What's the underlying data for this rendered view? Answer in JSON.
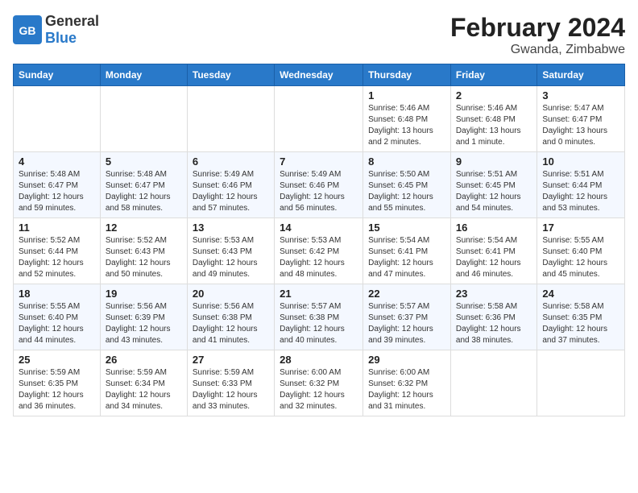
{
  "header": {
    "logo_general": "General",
    "logo_blue": "Blue",
    "month_year": "February 2024",
    "location": "Gwanda, Zimbabwe"
  },
  "days_of_week": [
    "Sunday",
    "Monday",
    "Tuesday",
    "Wednesday",
    "Thursday",
    "Friday",
    "Saturday"
  ],
  "weeks": [
    [
      {
        "day": "",
        "detail": ""
      },
      {
        "day": "",
        "detail": ""
      },
      {
        "day": "",
        "detail": ""
      },
      {
        "day": "",
        "detail": ""
      },
      {
        "day": "1",
        "detail": "Sunrise: 5:46 AM\nSunset: 6:48 PM\nDaylight: 13 hours\nand 2 minutes."
      },
      {
        "day": "2",
        "detail": "Sunrise: 5:46 AM\nSunset: 6:48 PM\nDaylight: 13 hours\nand 1 minute."
      },
      {
        "day": "3",
        "detail": "Sunrise: 5:47 AM\nSunset: 6:47 PM\nDaylight: 13 hours\nand 0 minutes."
      }
    ],
    [
      {
        "day": "4",
        "detail": "Sunrise: 5:48 AM\nSunset: 6:47 PM\nDaylight: 12 hours\nand 59 minutes."
      },
      {
        "day": "5",
        "detail": "Sunrise: 5:48 AM\nSunset: 6:47 PM\nDaylight: 12 hours\nand 58 minutes."
      },
      {
        "day": "6",
        "detail": "Sunrise: 5:49 AM\nSunset: 6:46 PM\nDaylight: 12 hours\nand 57 minutes."
      },
      {
        "day": "7",
        "detail": "Sunrise: 5:49 AM\nSunset: 6:46 PM\nDaylight: 12 hours\nand 56 minutes."
      },
      {
        "day": "8",
        "detail": "Sunrise: 5:50 AM\nSunset: 6:45 PM\nDaylight: 12 hours\nand 55 minutes."
      },
      {
        "day": "9",
        "detail": "Sunrise: 5:51 AM\nSunset: 6:45 PM\nDaylight: 12 hours\nand 54 minutes."
      },
      {
        "day": "10",
        "detail": "Sunrise: 5:51 AM\nSunset: 6:44 PM\nDaylight: 12 hours\nand 53 minutes."
      }
    ],
    [
      {
        "day": "11",
        "detail": "Sunrise: 5:52 AM\nSunset: 6:44 PM\nDaylight: 12 hours\nand 52 minutes."
      },
      {
        "day": "12",
        "detail": "Sunrise: 5:52 AM\nSunset: 6:43 PM\nDaylight: 12 hours\nand 50 minutes."
      },
      {
        "day": "13",
        "detail": "Sunrise: 5:53 AM\nSunset: 6:43 PM\nDaylight: 12 hours\nand 49 minutes."
      },
      {
        "day": "14",
        "detail": "Sunrise: 5:53 AM\nSunset: 6:42 PM\nDaylight: 12 hours\nand 48 minutes."
      },
      {
        "day": "15",
        "detail": "Sunrise: 5:54 AM\nSunset: 6:41 PM\nDaylight: 12 hours\nand 47 minutes."
      },
      {
        "day": "16",
        "detail": "Sunrise: 5:54 AM\nSunset: 6:41 PM\nDaylight: 12 hours\nand 46 minutes."
      },
      {
        "day": "17",
        "detail": "Sunrise: 5:55 AM\nSunset: 6:40 PM\nDaylight: 12 hours\nand 45 minutes."
      }
    ],
    [
      {
        "day": "18",
        "detail": "Sunrise: 5:55 AM\nSunset: 6:40 PM\nDaylight: 12 hours\nand 44 minutes."
      },
      {
        "day": "19",
        "detail": "Sunrise: 5:56 AM\nSunset: 6:39 PM\nDaylight: 12 hours\nand 43 minutes."
      },
      {
        "day": "20",
        "detail": "Sunrise: 5:56 AM\nSunset: 6:38 PM\nDaylight: 12 hours\nand 41 minutes."
      },
      {
        "day": "21",
        "detail": "Sunrise: 5:57 AM\nSunset: 6:38 PM\nDaylight: 12 hours\nand 40 minutes."
      },
      {
        "day": "22",
        "detail": "Sunrise: 5:57 AM\nSunset: 6:37 PM\nDaylight: 12 hours\nand 39 minutes."
      },
      {
        "day": "23",
        "detail": "Sunrise: 5:58 AM\nSunset: 6:36 PM\nDaylight: 12 hours\nand 38 minutes."
      },
      {
        "day": "24",
        "detail": "Sunrise: 5:58 AM\nSunset: 6:35 PM\nDaylight: 12 hours\nand 37 minutes."
      }
    ],
    [
      {
        "day": "25",
        "detail": "Sunrise: 5:59 AM\nSunset: 6:35 PM\nDaylight: 12 hours\nand 36 minutes."
      },
      {
        "day": "26",
        "detail": "Sunrise: 5:59 AM\nSunset: 6:34 PM\nDaylight: 12 hours\nand 34 minutes."
      },
      {
        "day": "27",
        "detail": "Sunrise: 5:59 AM\nSunset: 6:33 PM\nDaylight: 12 hours\nand 33 minutes."
      },
      {
        "day": "28",
        "detail": "Sunrise: 6:00 AM\nSunset: 6:32 PM\nDaylight: 12 hours\nand 32 minutes."
      },
      {
        "day": "29",
        "detail": "Sunrise: 6:00 AM\nSunset: 6:32 PM\nDaylight: 12 hours\nand 31 minutes."
      },
      {
        "day": "",
        "detail": ""
      },
      {
        "day": "",
        "detail": ""
      }
    ]
  ]
}
